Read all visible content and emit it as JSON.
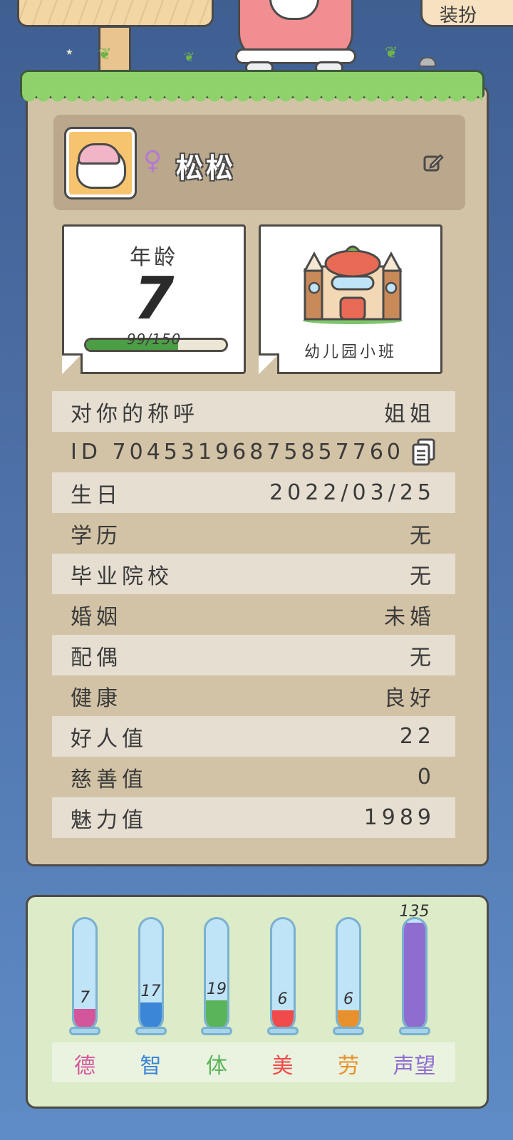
{
  "top_button": {
    "label": "装扮"
  },
  "profile": {
    "gender_symbol": "♀",
    "name": "松松"
  },
  "age": {
    "label": "年龄",
    "value": "7",
    "progress_text": "99/150",
    "progress_fraction": 0.66
  },
  "school": {
    "name": "幼儿园小班"
  },
  "info_rows": [
    {
      "label": "对你的称呼",
      "value": "姐姐"
    },
    {
      "label": "ID",
      "value": "70453196875857760"
    },
    {
      "label": "生日",
      "value": "2022/03/25"
    },
    {
      "label": "学历",
      "value": "无"
    },
    {
      "label": "毕业院校",
      "value": "无"
    },
    {
      "label": "婚姻",
      "value": "未婚"
    },
    {
      "label": "配偶",
      "value": "无"
    },
    {
      "label": "健康",
      "value": "良好"
    },
    {
      "label": "好人值",
      "value": "22"
    },
    {
      "label": "慈善值",
      "value": "0"
    },
    {
      "label": "魅力值",
      "value": "1989"
    }
  ],
  "stats": [
    {
      "label": "德",
      "value": "7",
      "color": "#d4569a",
      "fill": 0.18
    },
    {
      "label": "智",
      "value": "17",
      "color": "#3b86d6",
      "fill": 0.24
    },
    {
      "label": "体",
      "value": "19",
      "color": "#5ab45a",
      "fill": 0.26
    },
    {
      "label": "美",
      "value": "6",
      "color": "#f04a4a",
      "fill": 0.17
    },
    {
      "label": "劳",
      "value": "6",
      "color": "#e8902c",
      "fill": 0.17
    },
    {
      "label": "声望",
      "value": "135",
      "color": "#8f6cd0",
      "fill": 0.97
    }
  ],
  "colors": {
    "background": "#4c6fa6",
    "card": "#d3c3a6",
    "stats_panel": "#dcebc8",
    "age_bar": "#4c9e45"
  }
}
